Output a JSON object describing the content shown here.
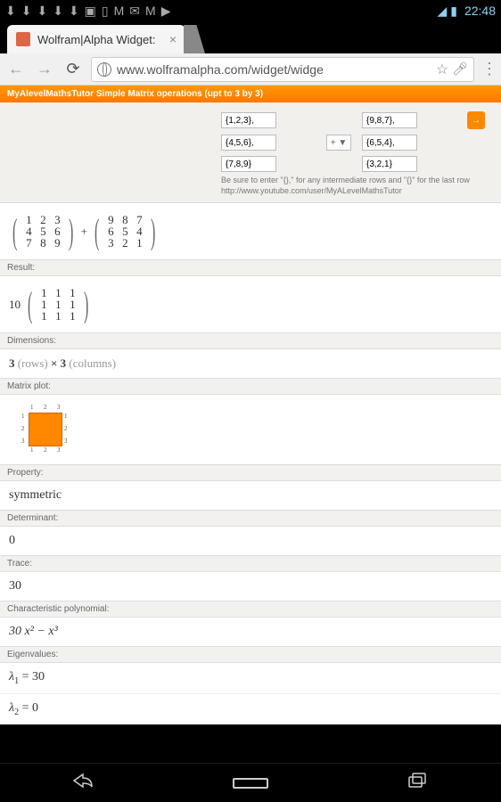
{
  "status": {
    "time": "22:48"
  },
  "tab": {
    "title": "Wolfram|Alpha Widget:"
  },
  "url": {
    "text": "www.wolframalpha.com/widget/widge"
  },
  "widget": {
    "header": "MyAlevelMathsTutor Simple Matrix operations (upt to 3 by 3)",
    "inputs": {
      "r1a": "{1,2,3},",
      "r1b": "{9,8,7},",
      "r2a": "{4,5,6},",
      "r2b": "{6,5,4},",
      "r3a": "{7,8,9}",
      "r3b": "{3,2,1}",
      "op": "+ ▼"
    },
    "hint": "Be sure to enter \"{},\" for any intermediate rows and \"{}\" for the last row",
    "link": "http://www.youtube.com/user/MyALevelMathsTutor",
    "go": "→"
  },
  "sections": {
    "input_label": "",
    "matrix_a": [
      [
        "1",
        "2",
        "3"
      ],
      [
        "4",
        "5",
        "6"
      ],
      [
        "7",
        "8",
        "9"
      ]
    ],
    "matrix_b": [
      [
        "9",
        "8",
        "7"
      ],
      [
        "6",
        "5",
        "4"
      ],
      [
        "3",
        "2",
        "1"
      ]
    ],
    "plus": "+",
    "result_label": "Result:",
    "result_scalar": "10",
    "result_matrix": [
      [
        "1",
        "1",
        "1"
      ],
      [
        "1",
        "1",
        "1"
      ],
      [
        "1",
        "1",
        "1"
      ]
    ],
    "dimensions_label": "Dimensions:",
    "dimensions_rows": "3",
    "dimensions_rowsw": "(rows)",
    "dimensions_x": "×",
    "dimensions_cols": "3",
    "dimensions_colsw": "(columns)",
    "plot_label": "Matrix plot:",
    "plot_ticks": [
      "1",
      "2",
      "3"
    ],
    "property_label": "Property:",
    "property": "symmetric",
    "det_label": "Determinant:",
    "det": "0",
    "trace_label": "Trace:",
    "trace": "30",
    "char_label": "Characteristic polynomial:",
    "char": "30 x² − x³",
    "eig_label": "Eigenvalues:",
    "eig1_l": "λ",
    "eig1_s": "1",
    "eig1_v": " = 30",
    "eig2_l": "λ",
    "eig2_s": "2",
    "eig2_v": " = 0"
  },
  "chart_data": {
    "type": "heatmap",
    "title": "Matrix plot",
    "x_ticks": [
      1,
      2,
      3
    ],
    "y_ticks": [
      1,
      2,
      3
    ],
    "values": [
      [
        1,
        1,
        1
      ],
      [
        1,
        1,
        1
      ],
      [
        1,
        1,
        1
      ]
    ],
    "color": "#ff8800"
  }
}
